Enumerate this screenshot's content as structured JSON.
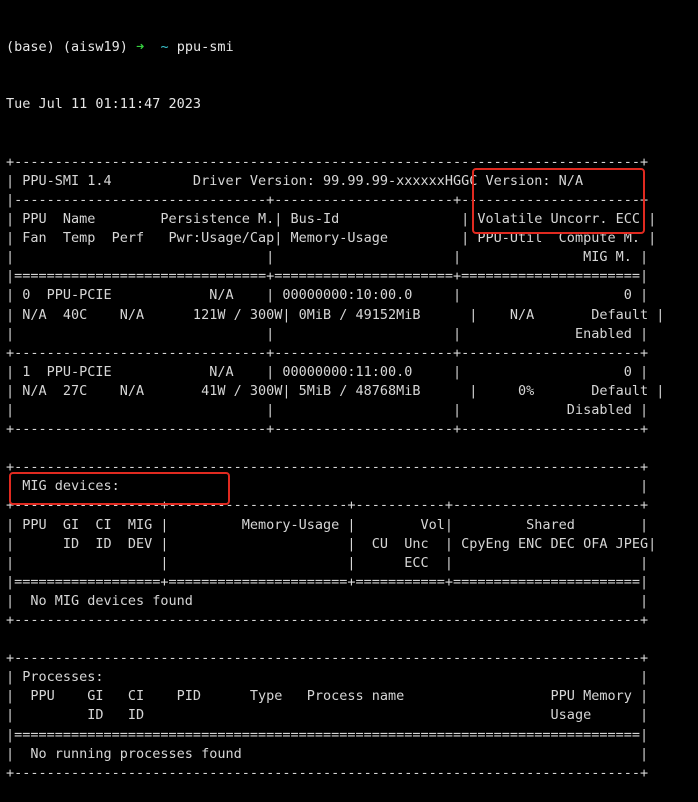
{
  "prompt": {
    "env": "(base) (aisw19)",
    "arrow": "➜",
    "cwd": "~",
    "command": "ppu-smi"
  },
  "timestamp": "Tue Jul 11 01:11:47 2023",
  "table_lines": [
    "+-----------------------------------------------------------------------------+",
    "| PPU-SMI 1.4          Driver Version: 99.99.99-xxxxxxHGGC Version: N/A       |",
    "|-------------------------------+----------------------+----------------------+",
    "| PPU  Name        Persistence M.| Bus-Id               | Volatile Uncorr. ECC |",
    "| Fan  Temp  Perf   Pwr:Usage/Cap| Memory-Usage         | PPU-Util  Compute M. |",
    "|                               |                      |               MIG M. |",
    "|===============================+======================+======================|",
    "| 0  PPU-PCIE            N/A    | 00000000:10:00.0     |                    0 |",
    "| N/A  40C    N/A      121W / 300W| 0MiB / 49152MiB      |    N/A       Default |",
    "|                               |                      |              Enabled |",
    "+-------------------------------+----------------------+----------------------+",
    "| 1  PPU-PCIE            N/A    | 00000000:11:00.0     |                    0 |",
    "| N/A  27C    N/A       41W / 300W| 5MiB / 48768MiB      |     0%       Default |",
    "|                               |                      |             Disabled |",
    "+-------------------------------+----------------------+----------------------+",
    "",
    "+-----------------------------------------------------------------------------+",
    "| MIG devices:                                                                |",
    "+------------------+----------------------+-----------+-----------------------+",
    "| PPU  GI  CI  MIG |         Memory-Usage |        Vol|         Shared        |",
    "|      ID  ID  DEV |                      |  CU  Unc  | CpyEng ENC DEC OFA JPEG|",
    "|                  |                      |      ECC  |                       |",
    "|==================+======================+===========+=======================|",
    "|  No MIG devices found                                                       |",
    "+-----------------------------------------------------------------------------+",
    "",
    "+-----------------------------------------------------------------------------+",
    "| Processes:                                                                  |",
    "|  PPU    GI   CI    PID      Type   Process name                  PPU Memory |",
    "|         ID   ID                                                  Usage      |",
    "|=============================================================================|",
    "|  No running processes found                                                 |",
    "+-----------------------------------------------------------------------------+"
  ],
  "highlight_color": "#e02a20"
}
